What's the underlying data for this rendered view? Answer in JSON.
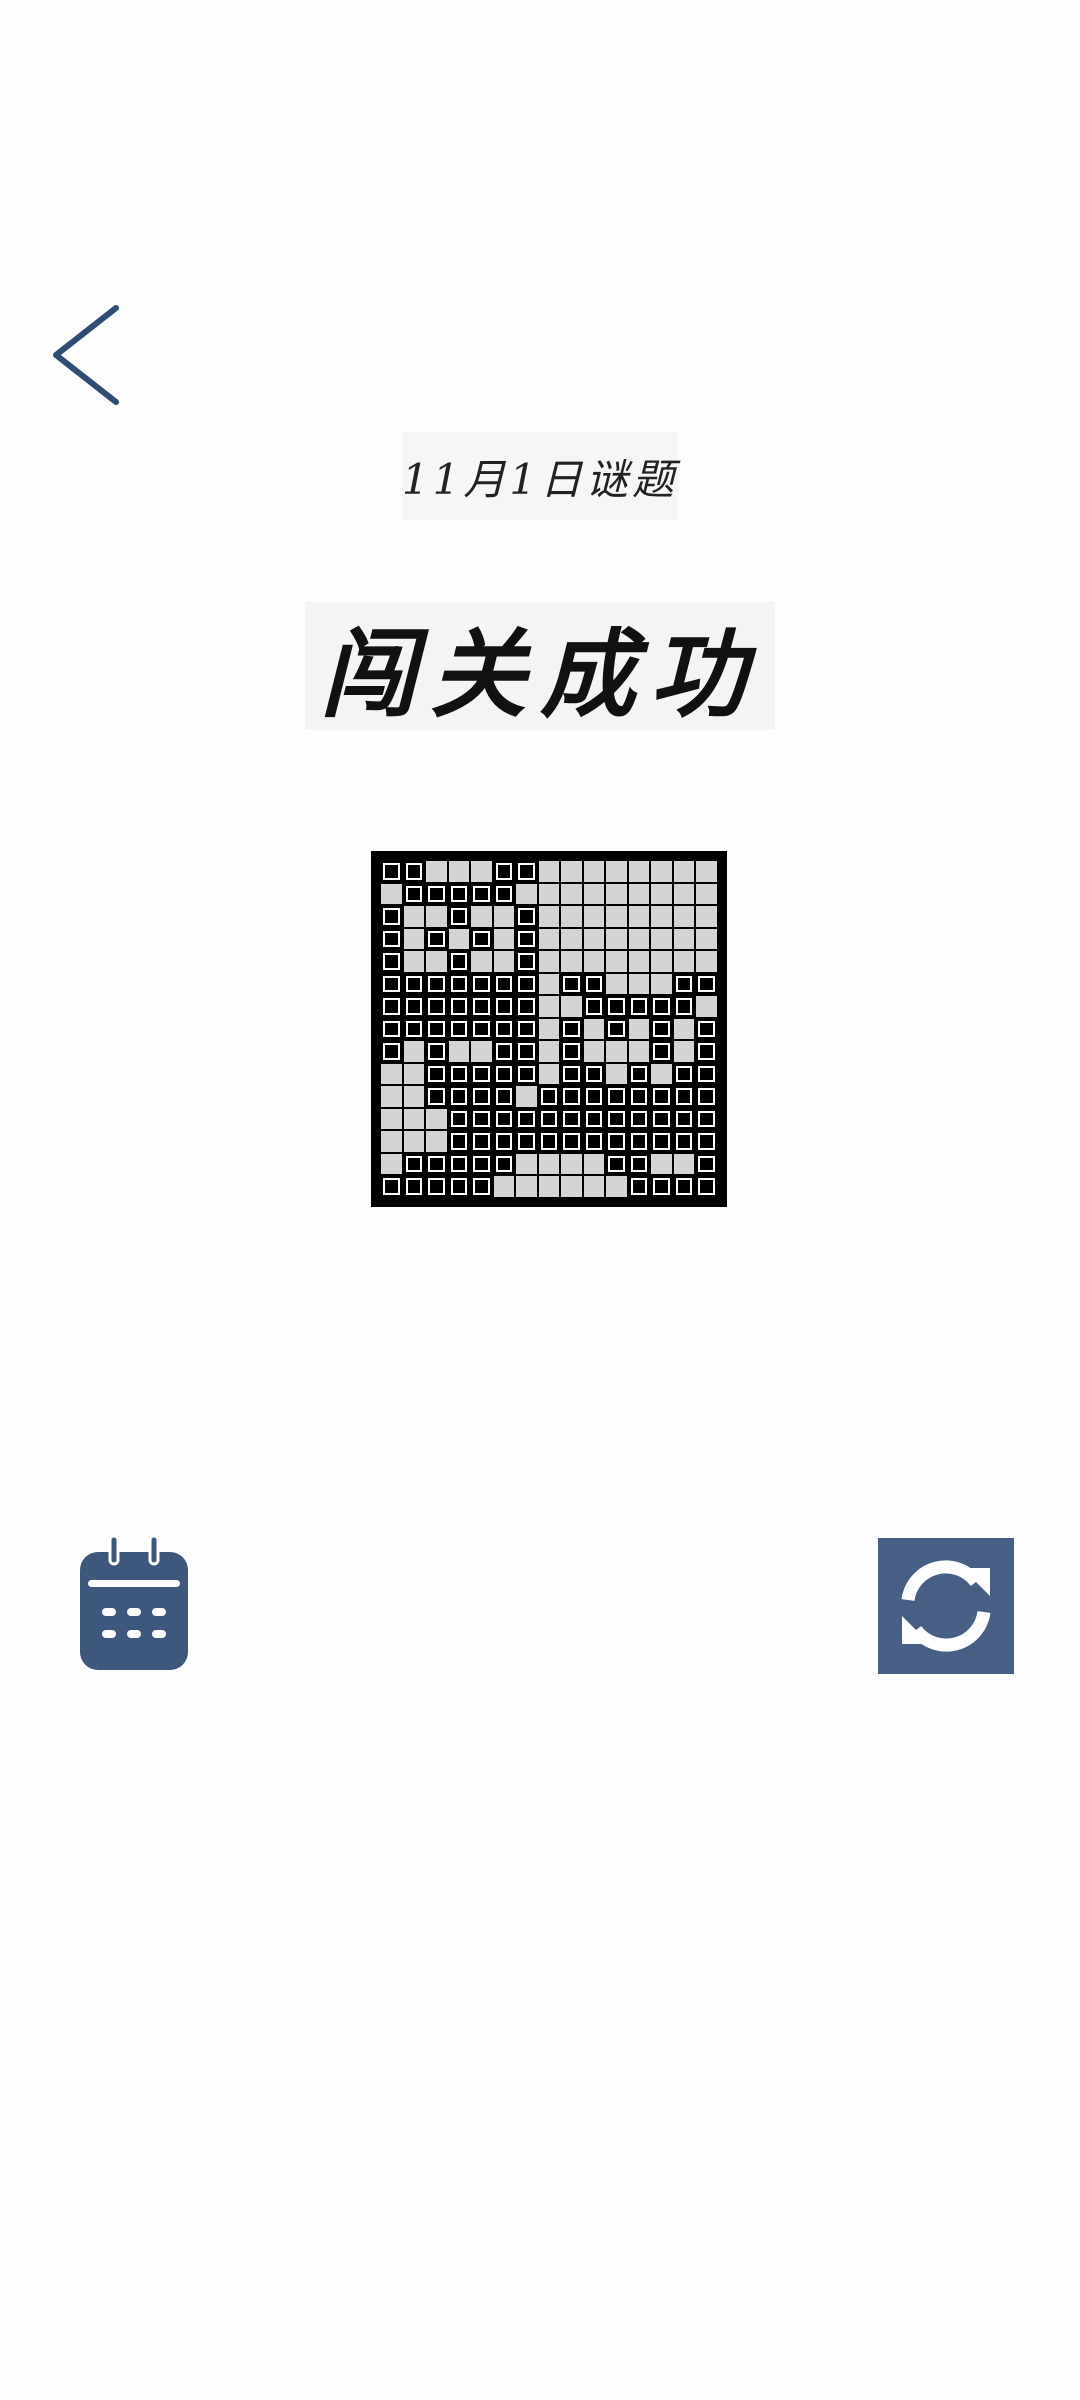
{
  "header": {
    "subtitle": "11月1日谜题",
    "title": "闯关成功"
  },
  "icons": {
    "back": "chevron-left-icon",
    "calendar": "calendar-icon",
    "refresh": "refresh-icon"
  },
  "colors": {
    "accent": "#475f84",
    "cell_filled": "#000000",
    "cell_empty": "#d4d4d4"
  },
  "puzzle": {
    "rows": 15,
    "cols": 15,
    "grid": [
      "110001100000000",
      "011111000000000",
      "100100100000000",
      "101010100000000",
      "100100100000000",
      "111111101100011",
      "111111100111110",
      "111111101010101",
      "101001101000101",
      "001111101101011",
      "001111011111111",
      "000111111111111",
      "000111111111111",
      "011111000011001",
      "111110000001111"
    ]
  }
}
